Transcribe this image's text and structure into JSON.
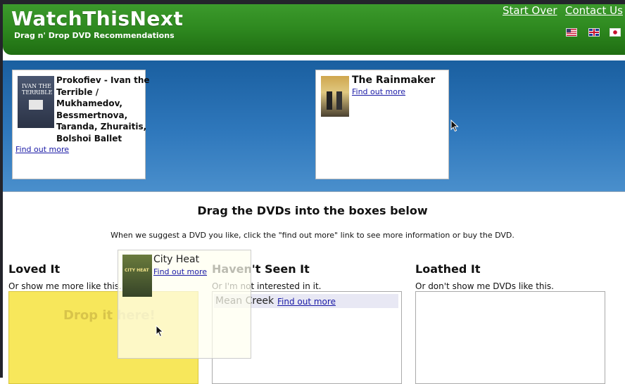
{
  "header": {
    "brand": "WatchThisNext",
    "tagline": "Drag n' Drop DVD Recommendations",
    "links": [
      "Start Over",
      "Contact Us"
    ],
    "flags": [
      "us-flag-icon",
      "gb-flag-icon",
      "jp-flag-icon"
    ],
    "color": "#2f8a20"
  },
  "banner": {
    "color": "#2f78bc",
    "dvds": [
      {
        "title": "Prokofiev - Ivan the Terrible / Mukhamedov, Bessmertnova, Taranda, Zhuraitis, Bolshoi Ballet",
        "title_lines": [
          "Prokofiev - Ivan the",
          "Terrible /",
          "Mukhamedov,",
          "Bessmertnova,",
          "Taranda, Zhuraitis,",
          "Bolshoi Ballet"
        ],
        "cover_text": "IVAN THE TERRIBLE",
        "link": "Find out more"
      },
      {
        "title": "The Rainmaker",
        "link": "Find out more"
      }
    ]
  },
  "main": {
    "heading": "Drag the DVDs into the boxes below",
    "subheading": "When we suggest a DVD you like, click the \"find out more\" link to see more information or buy the DVD.",
    "columns": [
      {
        "title": "Loved It",
        "subtitle": "Or show me more like this.",
        "hint": "Drop it here!",
        "color": "#f7e75b"
      },
      {
        "title": "Haven't Seen It",
        "subtitle": "Or I'm not interested in it.",
        "items": [
          {
            "title": "Mean Creek",
            "link": "Find out more"
          }
        ]
      },
      {
        "title": "Loathed It",
        "subtitle": "Or don't show me DVDs like this."
      }
    ]
  },
  "dragging": {
    "title": "City Heat",
    "cover_text": "CITY HEAT",
    "link": "Find out more"
  }
}
